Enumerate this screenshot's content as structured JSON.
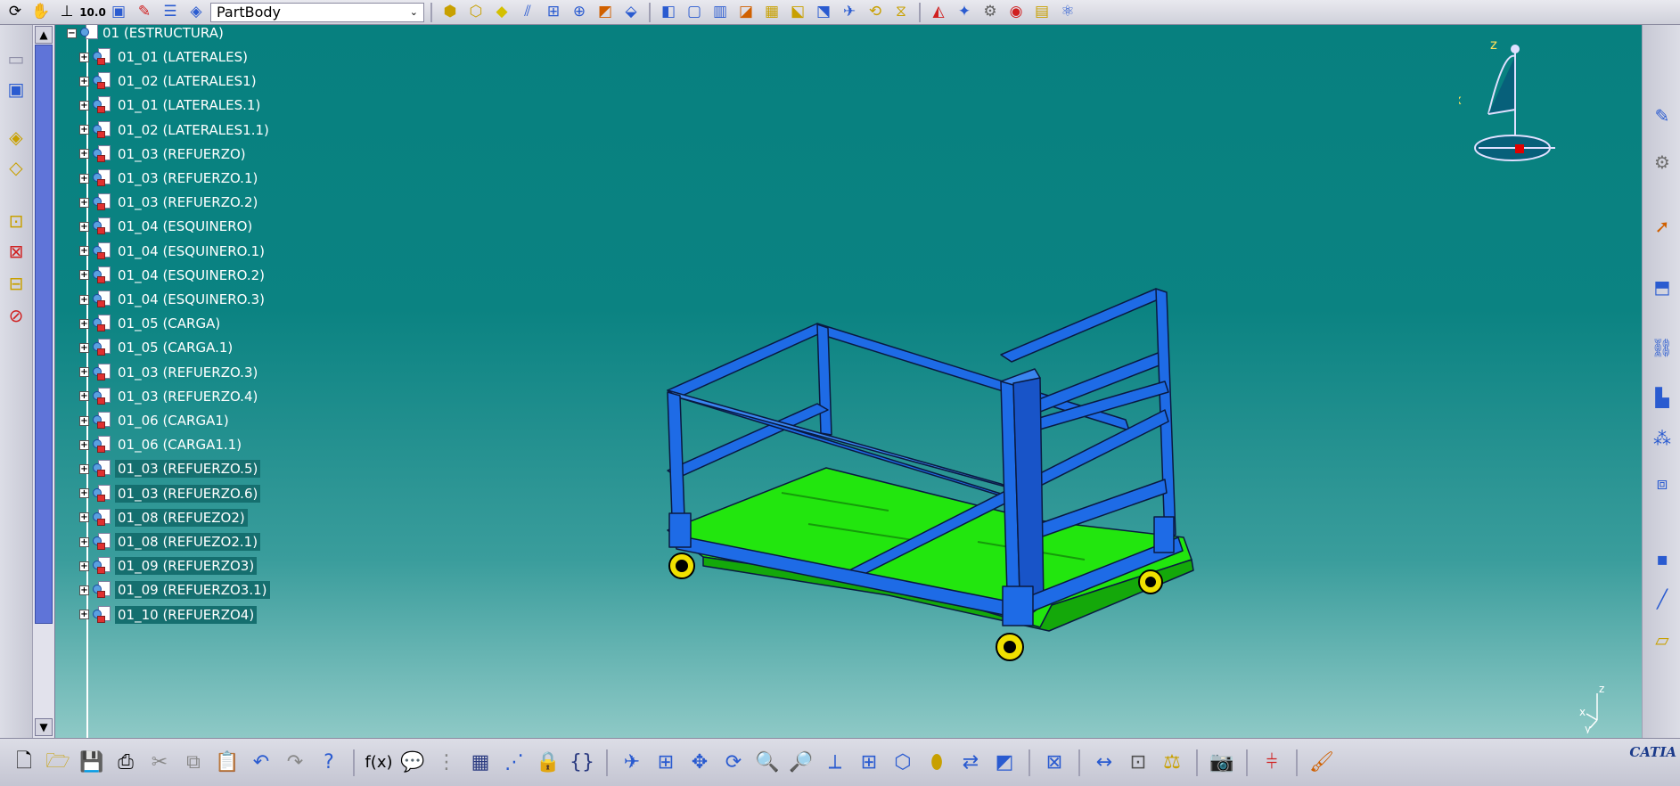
{
  "top_toolbar": {
    "body_select_value": "PartBody",
    "icons_left": [
      "refresh-icon",
      "hand-icon",
      "axis-icon",
      "scale-icon",
      "select-box-icon",
      "sketch-icon",
      "list-icon",
      "layers-icon"
    ],
    "icons_right": [
      "pad-icon",
      "pocket-icon",
      "shaft-icon",
      "rib-icon",
      "hole-icon",
      "target-icon",
      "fillet-icon",
      "chamfer-icon",
      "draft-icon",
      "shell-icon",
      "thickness-icon",
      "split-icon",
      "thread-icon",
      "pattern-icon",
      "mirror-icon",
      "translate-icon",
      "rotate-icon",
      "symmetry-icon",
      "boolean-icon",
      "assemble-icon",
      "add-icon",
      "remove-icon",
      "intersect-icon",
      "union-trim-icon",
      "remove-lump-icon",
      "measure-icon",
      "material-icon",
      "render-icon",
      "catalog-icon"
    ]
  },
  "tree": {
    "root_label": "01 (ESTRUCTURA)",
    "items": [
      {
        "label": "01_01 (LATERALES)",
        "highlight": false
      },
      {
        "label": "01_02 (LATERALES1)",
        "highlight": false
      },
      {
        "label": "01_01 (LATERALES.1)",
        "highlight": false
      },
      {
        "label": "01_02 (LATERALES1.1)",
        "highlight": false
      },
      {
        "label": "01_03 (REFUERZO)",
        "highlight": false
      },
      {
        "label": "01_03 (REFUERZO.1)",
        "highlight": false
      },
      {
        "label": "01_03 (REFUERZO.2)",
        "highlight": false
      },
      {
        "label": "01_04 (ESQUINERO)",
        "highlight": false
      },
      {
        "label": "01_04 (ESQUINERO.1)",
        "highlight": false
      },
      {
        "label": "01_04 (ESQUINERO.2)",
        "highlight": false
      },
      {
        "label": "01_04 (ESQUINERO.3)",
        "highlight": false
      },
      {
        "label": "01_05 (CARGA)",
        "highlight": false
      },
      {
        "label": "01_05 (CARGA.1)",
        "highlight": false
      },
      {
        "label": "01_03 (REFUERZO.3)",
        "highlight": false
      },
      {
        "label": "01_03 (REFUERZO.4)",
        "highlight": false
      },
      {
        "label": "01_06 (CARGA1)",
        "highlight": false
      },
      {
        "label": "01_06 (CARGA1.1)",
        "highlight": false
      },
      {
        "label": "01_03 (REFUERZO.5)",
        "highlight": true
      },
      {
        "label": "01_03 (REFUERZO.6)",
        "highlight": true
      },
      {
        "label": "01_08 (REFUEZO2)",
        "highlight": true
      },
      {
        "label": "01_08 (REFUEZO2.1)",
        "highlight": true
      },
      {
        "label": "01_09 (REFUERZO3)",
        "highlight": true
      },
      {
        "label": "01_09 (REFUERZO3.1)",
        "highlight": true
      },
      {
        "label": "01_10 (REFUERZO4)",
        "highlight": true
      }
    ]
  },
  "compass": {
    "z": "z",
    "x": "x",
    "y": "y"
  },
  "mini_axis": {
    "z": "z",
    "x": "x",
    "y": "y"
  },
  "bottom_toolbar": {
    "icons": [
      "new-icon",
      "open-icon",
      "save-icon",
      "print-icon",
      "cut-icon",
      "copy-icon",
      "paste-icon",
      "undo-icon",
      "redo-icon",
      "whats-this-icon",
      "formula-icon",
      "comment-icon",
      "knowledge-icon",
      "table-icon",
      "graph-icon",
      "lock-icon",
      "parameters-icon",
      "fly-mode-icon",
      "fit-all-icon",
      "pan-icon",
      "rotate-view-icon",
      "zoom-in-icon",
      "zoom-out-icon",
      "normal-view-icon",
      "multi-view-icon",
      "iso-view-icon",
      "hide-show-icon",
      "swap-visible-icon",
      "shading-icon",
      "catalog-browser-icon",
      "measure-between-icon",
      "measure-item-icon",
      "measure-inertia-icon",
      "capture-icon",
      "analysis-icon",
      "apply-material-icon"
    ],
    "logo_text": "CATIA"
  },
  "colors": {
    "viewport_top": "#07807f",
    "frame_blue": "#1e6be6",
    "deck_green": "#22e60e",
    "wheel_yellow": "#f0e000",
    "tree_highlight": "#156f6f"
  }
}
